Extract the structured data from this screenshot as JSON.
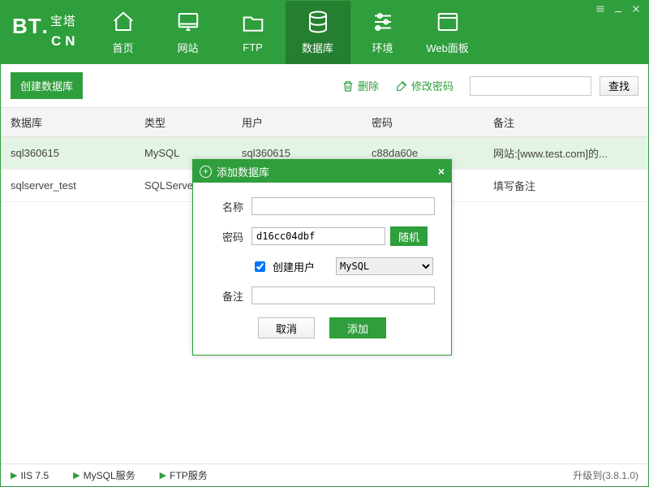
{
  "header": {
    "logo": {
      "bt": "BT",
      "zh": "宝塔",
      "cn": "CN"
    },
    "nav": [
      {
        "label": "首页"
      },
      {
        "label": "网站"
      },
      {
        "label": "FTP"
      },
      {
        "label": "数据库"
      },
      {
        "label": "环境"
      },
      {
        "label": "Web面板"
      }
    ]
  },
  "toolbar": {
    "create_label": "创建数据库",
    "delete_label": "删除",
    "change_pw_label": "修改密码",
    "search_value": "",
    "search_label": "查找"
  },
  "table": {
    "columns": [
      "数据库",
      "类型",
      "用户",
      "密码",
      "备注"
    ],
    "rows": [
      {
        "db": "sql360615",
        "type": "MySQL",
        "user": "sql360615",
        "pass": "c88da60e",
        "remark": "网站:[www.test.com]的..."
      },
      {
        "db": "sqlserver_test",
        "type": "SQLServer",
        "user": "",
        "pass": "",
        "remark": "填写备注"
      }
    ]
  },
  "status": {
    "items": [
      "IIS 7.5",
      "MySQL服务",
      "FTP服务"
    ],
    "version": "升级到(3.8.1.0)"
  },
  "modal": {
    "title": "添加数据库",
    "labels": {
      "name": "名称",
      "password": "密码",
      "random": "随机",
      "create_user": "创建用户",
      "remark": "备注",
      "cancel": "取消",
      "add": "添加"
    },
    "values": {
      "name": "",
      "password": "d16cc04dbf",
      "db_type": "MySQL",
      "remark": ""
    }
  }
}
